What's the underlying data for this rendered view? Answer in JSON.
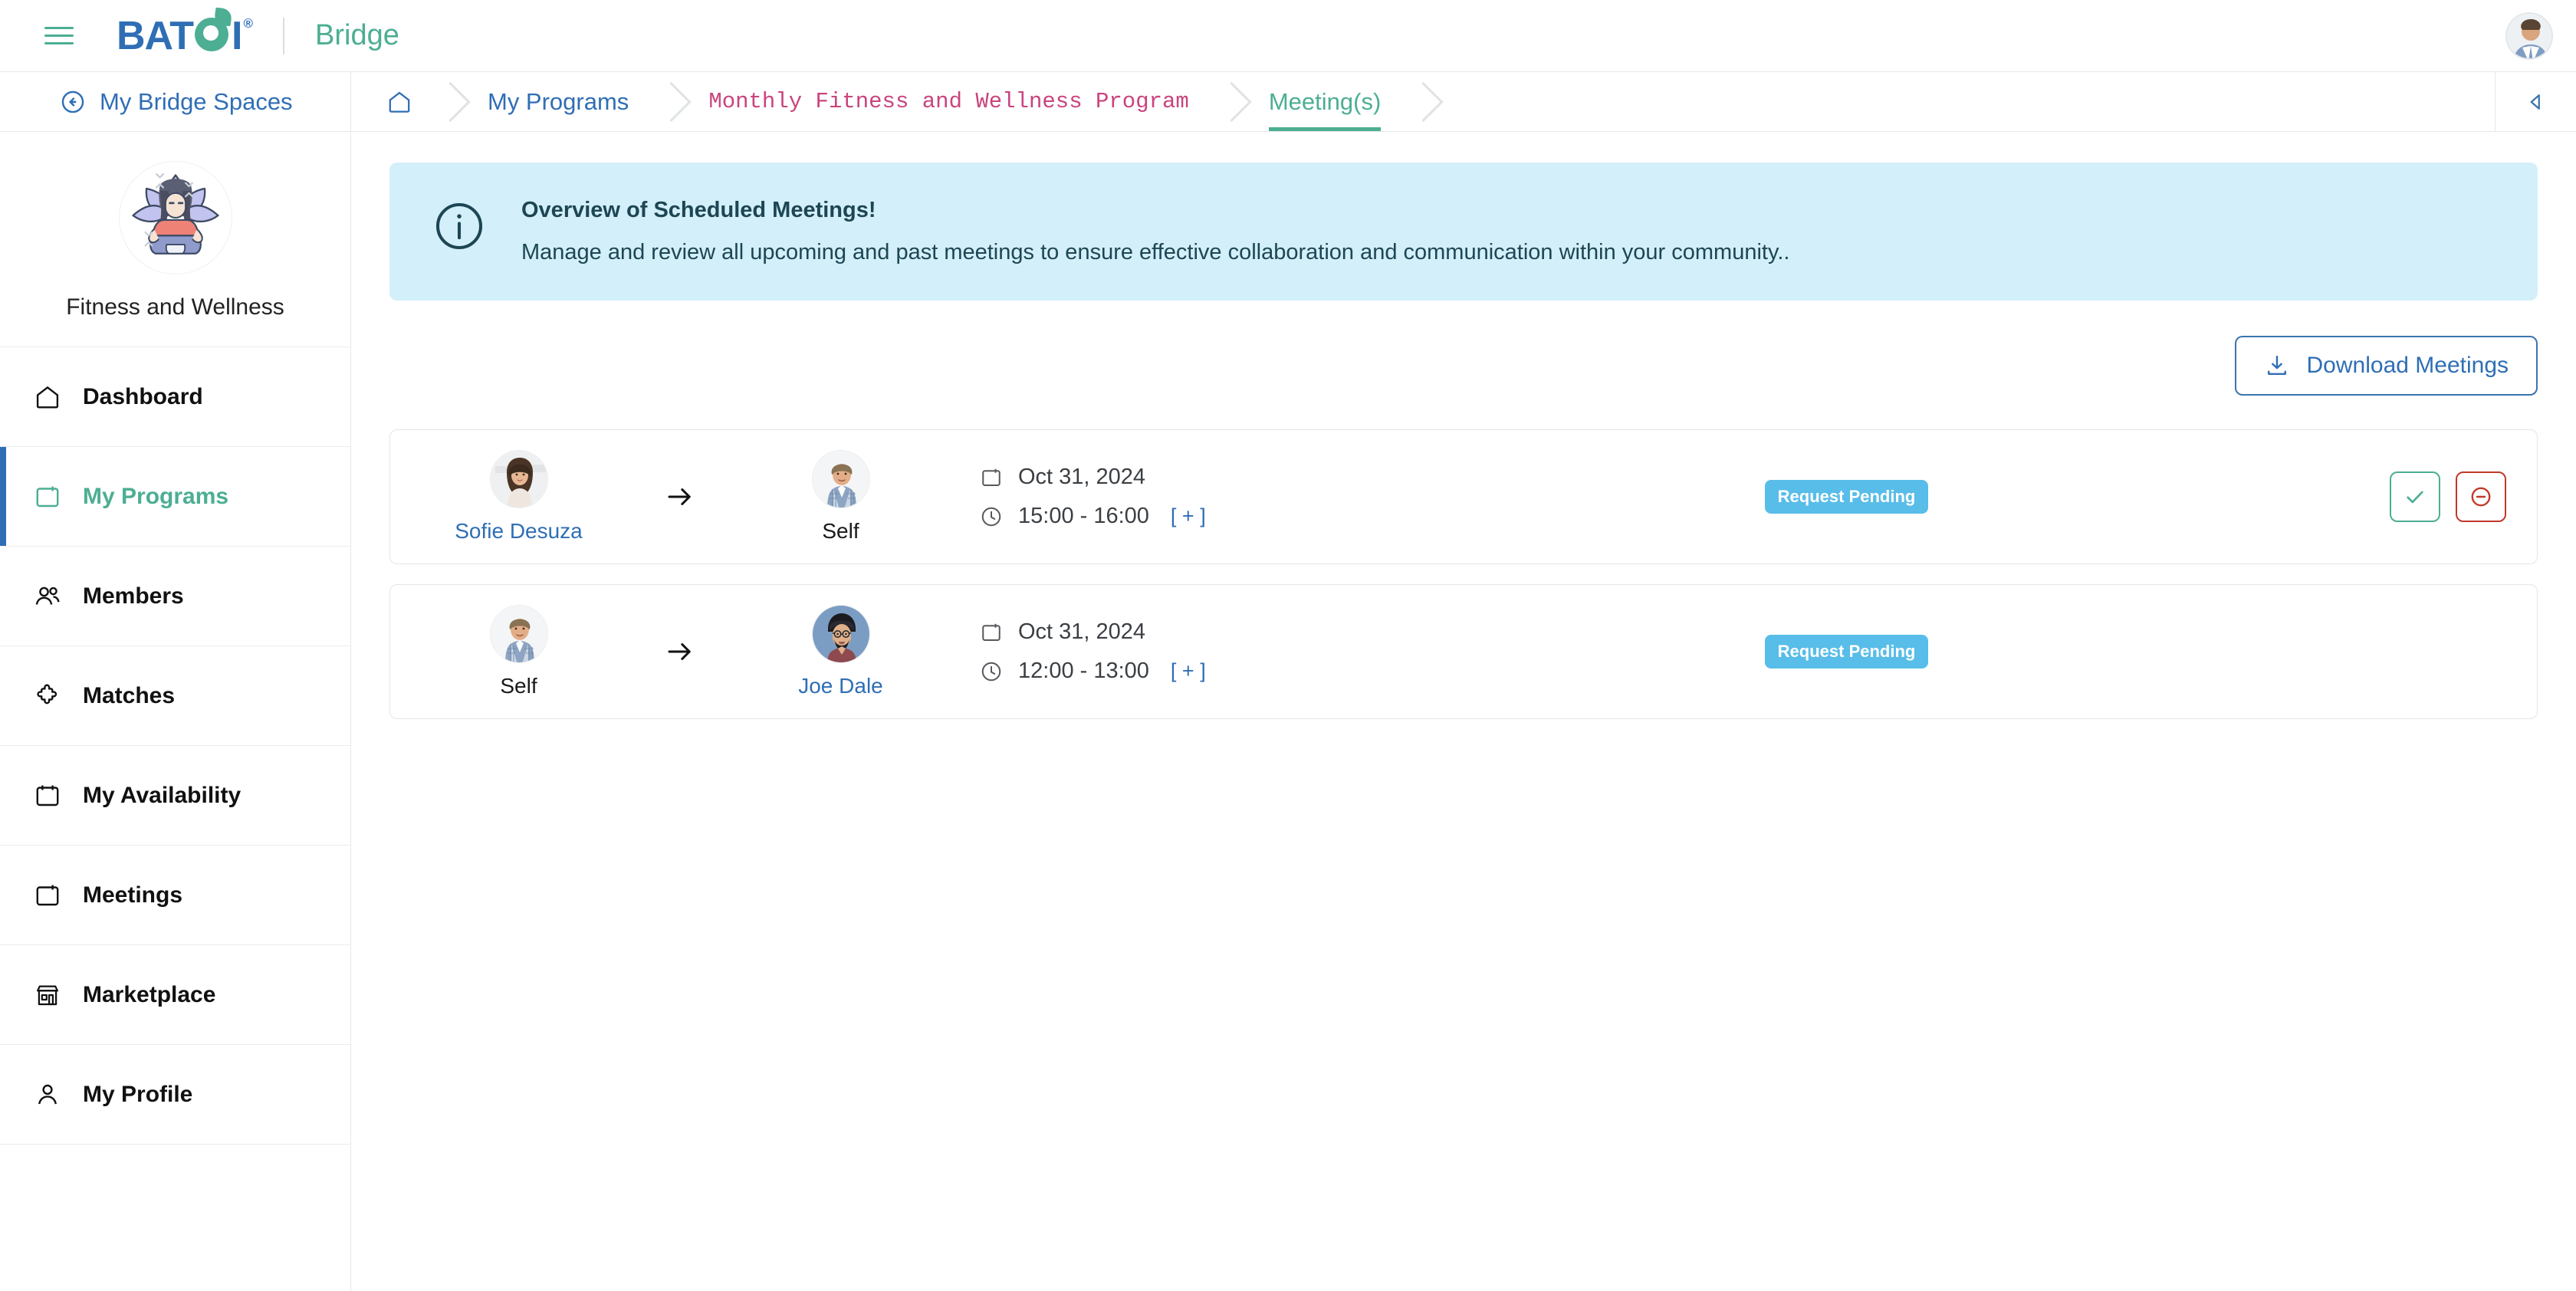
{
  "brand": {
    "logo_text": "BATOI",
    "logo_registered": "®",
    "product": "Bridge",
    "accent_green": "#4cae93",
    "accent_blue": "#2f6eb5",
    "accent_pink": "#c9447e",
    "badge_blue": "#58bde8",
    "banner_bg": "#d3eff9"
  },
  "topbar": {
    "menu_icon": "hamburger-icon",
    "avatar_icon": "user-avatar"
  },
  "breadcrumb": {
    "back_label": "My Bridge Spaces",
    "back_icon": "arrow-left-circle-icon",
    "home_icon": "home-icon",
    "items": [
      {
        "label": "My Programs",
        "state": "link"
      },
      {
        "label": "Monthly Fitness and Wellness Program",
        "state": "program"
      },
      {
        "label": "Meeting(s)",
        "state": "active"
      }
    ],
    "collapse_icon": "chevron-left-icon"
  },
  "sidebar": {
    "space_name": "Fitness and Wellness",
    "space_avatar_icon": "yoga-meditation-avatar",
    "items": [
      {
        "label": "Dashboard",
        "icon": "home-icon",
        "active": false
      },
      {
        "label": "My Programs",
        "icon": "calendar-icon",
        "active": true
      },
      {
        "label": "Members",
        "icon": "users-icon",
        "active": false
      },
      {
        "label": "Matches",
        "icon": "puzzle-icon",
        "active": false
      },
      {
        "label": "My Availability",
        "icon": "calendar-icon",
        "active": false
      },
      {
        "label": "Meetings",
        "icon": "calendar-icon",
        "active": false
      },
      {
        "label": "Marketplace",
        "icon": "storefront-icon",
        "active": false
      },
      {
        "label": "My Profile",
        "icon": "person-icon",
        "active": false
      }
    ]
  },
  "banner": {
    "icon": "info-circle-icon",
    "title": "Overview of Scheduled Meetings!",
    "description": "Manage and review all upcoming and past meetings to ensure effective collaboration and communication within your community.."
  },
  "toolbar": {
    "download_label": "Download Meetings",
    "download_icon": "download-icon"
  },
  "meetings": {
    "date_icon": "calendar-icon",
    "time_icon": "clock-icon",
    "expand_label": "[ + ]",
    "arrow_icon": "arrow-right-icon",
    "accept_icon": "check-icon",
    "decline_icon": "circle-minus-icon",
    "rows": [
      {
        "from_name": "Sofie Desuza",
        "from_is_self": false,
        "from_avatar": "woman-smiling-avatar",
        "to_name": "Self",
        "to_is_self": true,
        "to_avatar": "man-plaid-shirt-avatar",
        "date": "Oct 31, 2024",
        "time": "15:00 - 16:00",
        "status": "Request Pending",
        "has_actions": true
      },
      {
        "from_name": "Self",
        "from_is_self": true,
        "from_avatar": "man-plaid-shirt-avatar",
        "to_name": "Joe Dale",
        "to_is_self": false,
        "to_avatar": "man-turban-memoji-avatar",
        "date": "Oct 31, 2024",
        "time": "12:00 - 13:00",
        "status": "Request Pending",
        "has_actions": false
      }
    ]
  }
}
